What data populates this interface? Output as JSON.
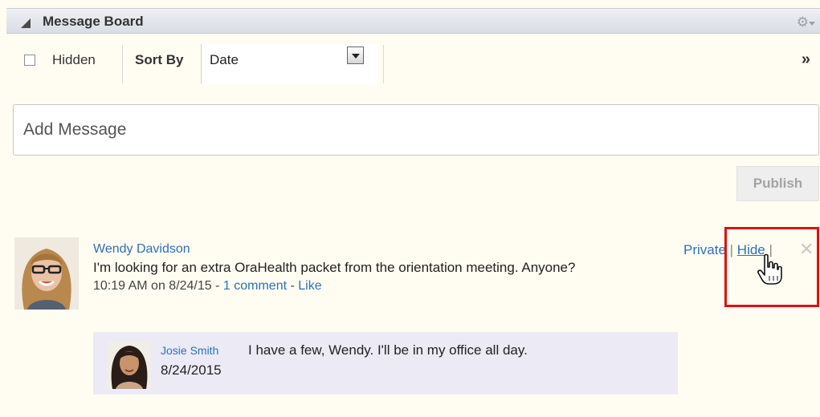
{
  "panel": {
    "title": "Message Board",
    "gear_icon": "gear-icon"
  },
  "toolbar": {
    "hidden_label": "Hidden",
    "hidden_checked": false,
    "sort_by_label": "Sort By",
    "sort_selected": "Date",
    "overflow_glyph": "»"
  },
  "composer": {
    "placeholder": "Add Message",
    "publish_label": "Publish"
  },
  "message": {
    "author": "Wendy Davidson",
    "text": "I'm looking for an extra OraHealth packet from the orientation meeting. Anyone?",
    "timestamp": "10:19 AM on 8/24/15",
    "comments_link": "1 comment",
    "like_link": "Like",
    "private_link": "Private",
    "hide_link": "Hide",
    "close_glyph": "✕"
  },
  "comment": {
    "author": "Josie Smith",
    "text": "I have a few, Wendy. I'll be in my office all day.",
    "date": "8/24/2015"
  },
  "colors": {
    "link": "#2f6fb7",
    "highlight": "#e01010",
    "background": "#fffdf2"
  }
}
